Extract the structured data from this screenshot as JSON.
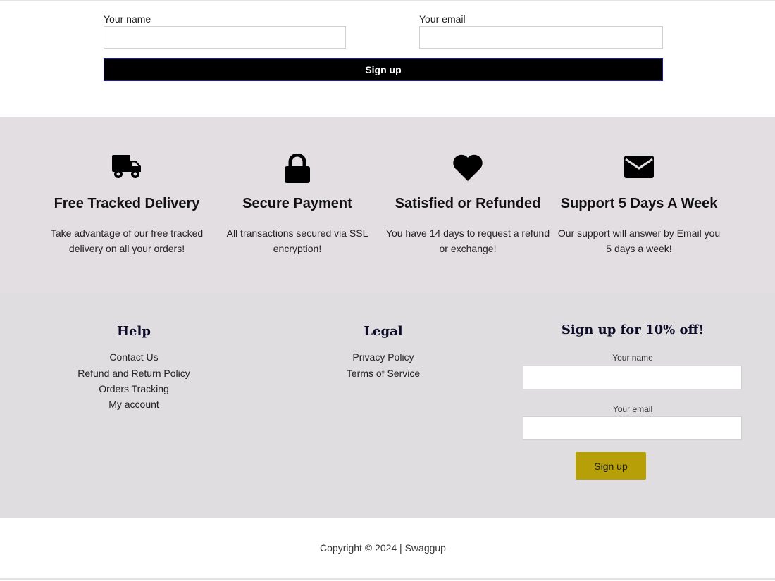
{
  "top_signup": {
    "name_label": "Your name",
    "email_label": "Your email",
    "button_label": "Sign up"
  },
  "features": [
    {
      "icon": "truck-icon",
      "title": "Free Tracked Delivery",
      "desc_line1": "Take advantage of our free tracked",
      "desc_line2": "delivery on all your orders!"
    },
    {
      "icon": "lock-icon",
      "title": "Secure Payment",
      "desc_line1": "All transactions secured via SSL",
      "desc_line2": "encryption!"
    },
    {
      "icon": "heart-icon",
      "title": "Satisfied or Refunded",
      "desc_line1": "You have 14 days to request a refund",
      "desc_line2": "or exchange!"
    },
    {
      "icon": "envelope-icon",
      "title": "Support 5 Days A Week",
      "desc_line1": "Our support will answer by Email you",
      "desc_line2": "5 days a week!"
    }
  ],
  "footer": {
    "help": {
      "title": "Help",
      "links": [
        "Contact Us",
        "Refund and Return Policy",
        "Orders Tracking",
        "My account"
      ]
    },
    "legal": {
      "title": "Legal",
      "links": [
        "Privacy Policy",
        "Terms of Service"
      ]
    },
    "signup": {
      "title": "Sign up for 10% off!",
      "name_label": "Your name",
      "email_label": "Your email",
      "button_label": "Sign up",
      "button_color": "#b7a007"
    }
  },
  "copyright": "Copyright © 2024 | Swaggup"
}
